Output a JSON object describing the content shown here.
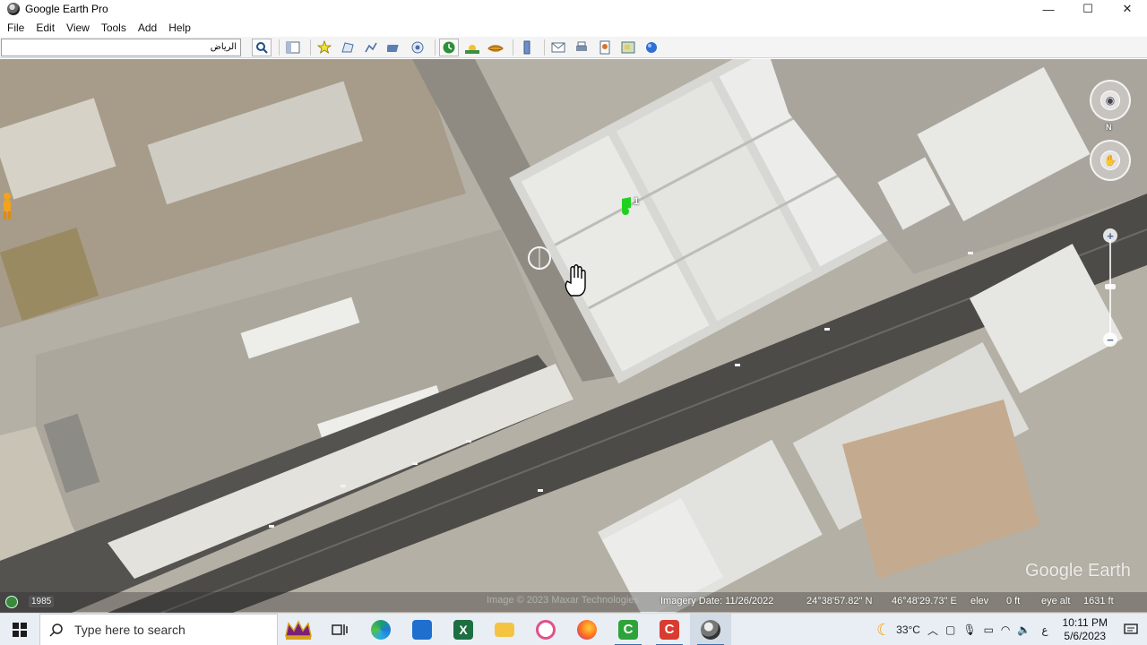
{
  "window": {
    "title": "Google Earth Pro",
    "controls": {
      "minimize": "—",
      "maximize": "☐",
      "close": "✕"
    }
  },
  "menu": {
    "items": [
      {
        "label": "File",
        "hotkey": "F"
      },
      {
        "label": "Edit",
        "hotkey": "E"
      },
      {
        "label": "View",
        "hotkey": "V"
      },
      {
        "label": "Tools",
        "hotkey": "T"
      },
      {
        "label": "Add",
        "hotkey": "A"
      },
      {
        "label": "Help",
        "hotkey": "H"
      }
    ]
  },
  "toolbar": {
    "search_value": "الرياض",
    "buttons": [
      "search-icon",
      "sidebar-toggle-icon",
      "placemark-icon",
      "polygon-icon",
      "path-icon",
      "image-overlay-icon",
      "record-tour-icon",
      "historical-imagery-icon",
      "sunlight-icon",
      "planets-icon",
      "ruler-icon",
      "email-icon",
      "print-icon",
      "save-image-icon",
      "view-in-maps-icon",
      "earth-icon"
    ]
  },
  "map": {
    "north_label": "N",
    "copyright": "Image © 2023 Maxar Technologies",
    "watermark": "Google Earth",
    "placemark_label": "1"
  },
  "status_bar": {
    "year": "1985",
    "imagery_date": "Imagery Date: 11/26/2022",
    "lat": "24°38'57.82\" N",
    "lon": "46°48'29.73\" E",
    "elev_label": "elev",
    "elev_value": "0 ft",
    "eye_alt_label": "eye alt",
    "eye_alt_value": "1631 ft"
  },
  "taskbar": {
    "search_placeholder": "Type here to search",
    "apps": [
      "crown-app-icon",
      "task-view-icon",
      "edge-icon",
      "mail-icon",
      "excel-icon",
      "file-explorer-icon",
      "app-icon-pink",
      "firefox-icon",
      "camtasia-green-icon",
      "camtasia-red-icon",
      "google-earth-taskbar-icon"
    ],
    "weather": "33°C",
    "language": "ع",
    "time": "10:11 PM",
    "date": "5/6/2023"
  },
  "colors": {
    "taskbar_bg": "#e9eef5",
    "ground": "#b9b3a7",
    "road": "#4a4a4a",
    "roof": "#e6e6e2",
    "placemark": "#1fd11f"
  }
}
